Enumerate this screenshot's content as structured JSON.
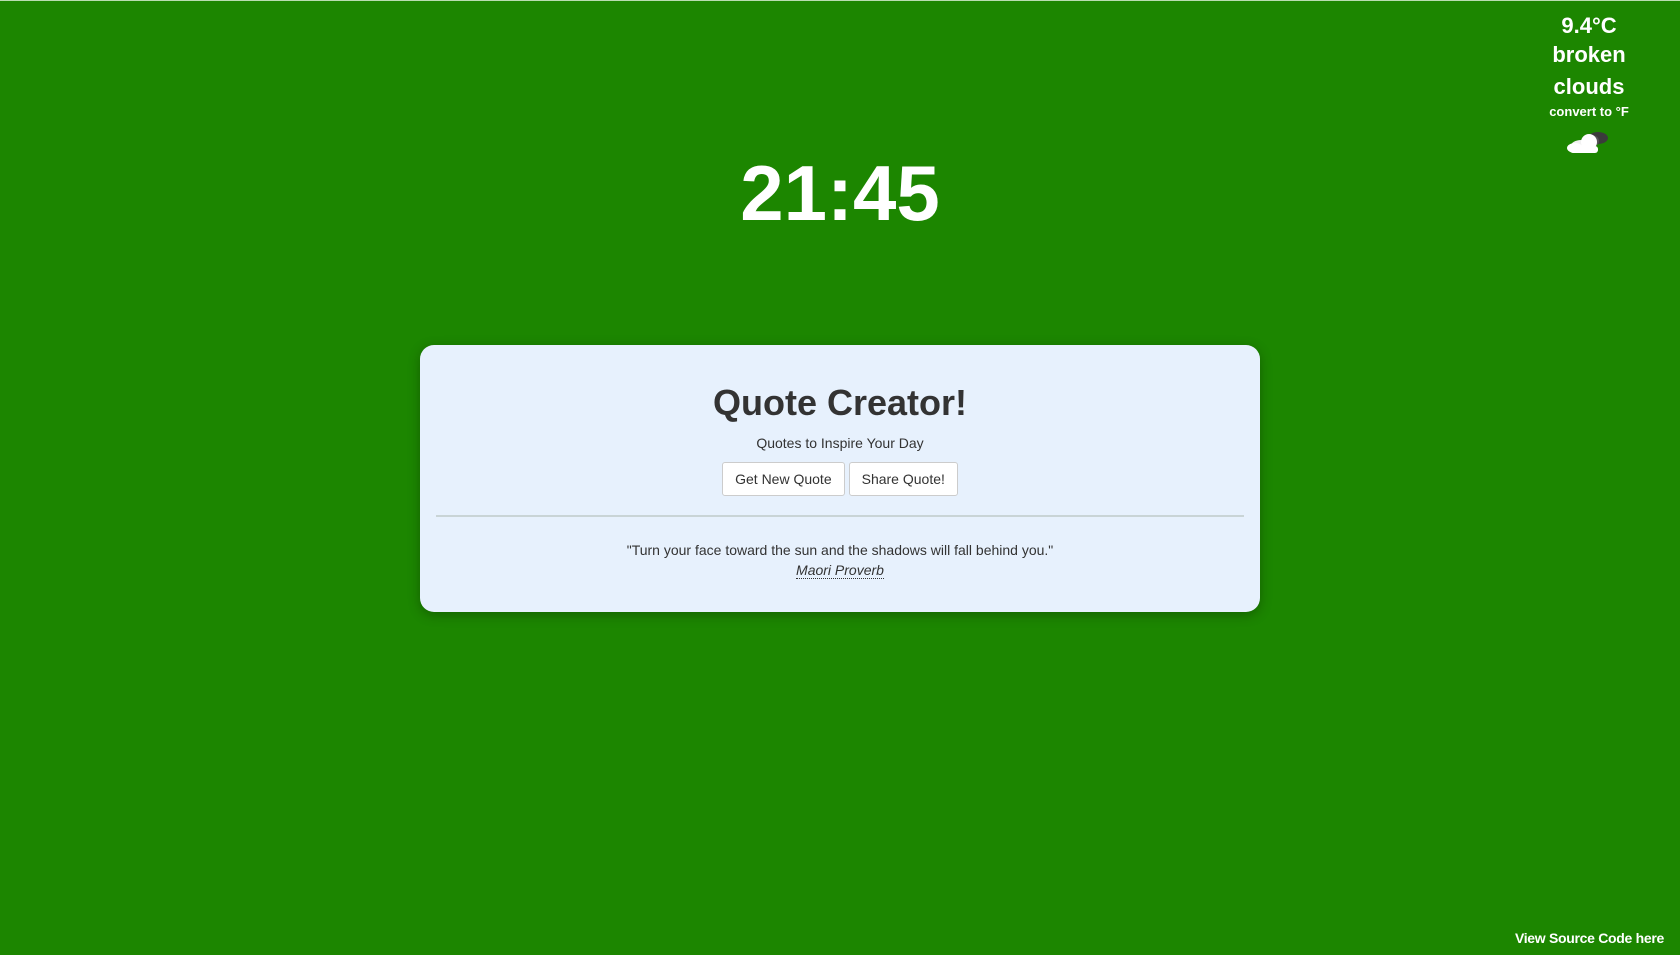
{
  "weather": {
    "temperature": "9.4°C",
    "condition": "broken clouds",
    "convert_label": "convert to °F",
    "icon": "broken-clouds-icon"
  },
  "clock": {
    "time": "21:45"
  },
  "card": {
    "title": "Quote Creator!",
    "subtitle": "Quotes to Inspire Your Day",
    "buttons": {
      "new_quote": "Get New Quote",
      "share_quote": "Share Quote!"
    },
    "quote": {
      "text": "\"Turn your face toward the sun and the shadows will fall behind you.\"",
      "author": "Maori Proverb"
    }
  },
  "footer": {
    "source_link": "View Source Code here"
  },
  "colors": {
    "background": "#1c8600",
    "card_background": "#e7f1fd",
    "text_light": "#ffffff",
    "text_dark": "#333333"
  }
}
